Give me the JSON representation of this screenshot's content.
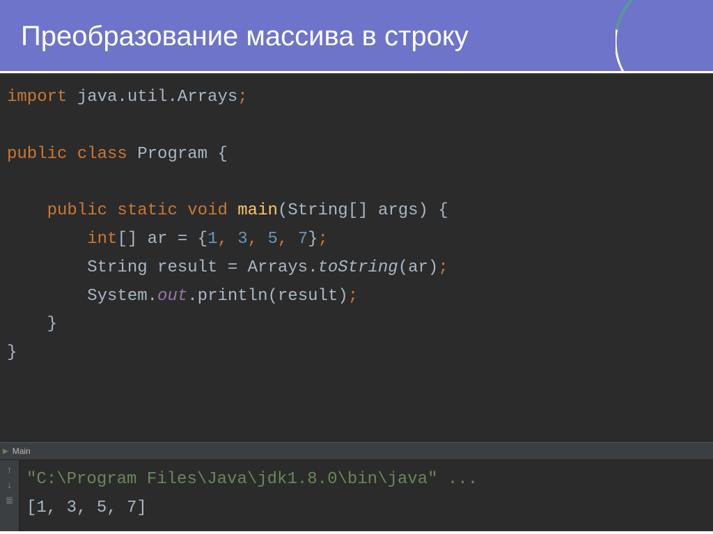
{
  "header": {
    "title": "Преобразование массива в строку"
  },
  "code": {
    "import_kw": "import",
    "import_pkg": " java.util.Arrays",
    "semicolon": ";",
    "public_kw": "public",
    "class_kw": " class",
    "class_name": " Program ",
    "open_brace": "{",
    "static_kw": " static",
    "void_kw": " void",
    "main_name": " main",
    "main_params_open": "(",
    "string_type": "String",
    "array_brackets": "[] ",
    "args_name": "args",
    "main_params_close": ") ",
    "int_kw": "int",
    "ar_decl_brackets": "[] ",
    "ar_name": "ar = ",
    "ar_open": "{",
    "n1": "1",
    "comma": ", ",
    "n2": "3",
    "n3": "5",
    "n4": "7",
    "ar_close": "}",
    "string_var": "String result = Arrays.",
    "tostring": "toString",
    "tostring_arg_open": "(",
    "tostring_arg": "ar",
    "tostring_arg_close": ")",
    "system": "System.",
    "out": "out",
    "println": ".println",
    "println_arg_open": "(",
    "println_arg": "result",
    "println_arg_close": ")",
    "close_brace": "}"
  },
  "tab": {
    "name": "Main"
  },
  "console": {
    "line1": "\"C:\\Program Files\\Java\\jdk1.8.0\\bin\\java\" ...",
    "line2": "[1, 3, 5, 7]"
  }
}
